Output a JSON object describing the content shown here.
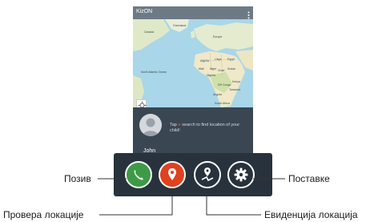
{
  "app": {
    "title": "KizON",
    "map_labels": [
      "North Atlantic Ocean",
      "Greenland",
      "Canada",
      "Europe",
      "Algeria",
      "Libya",
      "Egypt",
      "Mali",
      "Niger",
      "Sudan",
      "Nigeria",
      "Chad",
      "DR Congo",
      "Kenya",
      "Tanzania",
      "Angola",
      "South Africa"
    ],
    "child_name": "John",
    "hint_prefix": "Tap",
    "hint_suffix": "search to find location of your child!"
  },
  "callouts": {
    "call": "Позив",
    "settings": "Поставке",
    "location_check": "Провера локације",
    "location_log": "Евиденција локација"
  },
  "colors": {
    "call_button": "#3d9a45",
    "location_button": "#e0411f",
    "toolbar": "#27323d"
  },
  "icons": [
    "overflow-icon",
    "locate-icon",
    "phone-icon",
    "location-pin-icon",
    "location-history-icon",
    "gear-icon",
    "person-icon"
  ]
}
